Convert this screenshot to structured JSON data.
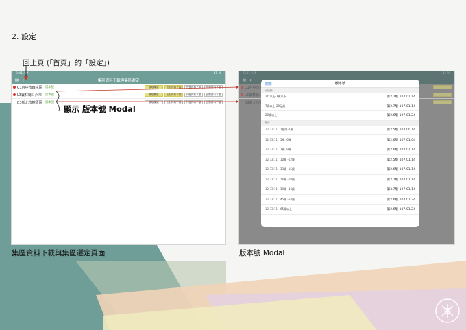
{
  "section": {
    "title": "2. 設定"
  },
  "annotations": {
    "back": "回上頁 (「首頁」的「設定」)",
    "open_modal": "顯示 版本號 Modal"
  },
  "captions": {
    "left": "集區資料下載與集區選定頁面",
    "right": "版本號 Modal"
  },
  "left_screen": {
    "status": {
      "time": "9:41 AM",
      "battery": "41 %"
    },
    "title": "集區資料下載與集區選定",
    "rows": [
      {
        "name": "C1台中市西屯區",
        "version": "版本號",
        "dot": true,
        "buttons": [
          {
            "label": "選取集區",
            "on": true
          },
          {
            "label": "比對資料下載",
            "on": true
          },
          {
            "label": "刊登資料下載",
            "on": false
          },
          {
            "label": "比對資料下載",
            "on": false
          }
        ]
      },
      {
        "name": "L3雲林縣斗六市",
        "version": "版本號",
        "dot": true,
        "buttons": [
          {
            "label": "選取集區",
            "on": true
          },
          {
            "label": "比對資料下載",
            "on": true
          },
          {
            "label": "刊登資料下載",
            "on": false
          },
          {
            "label": "比對資料下載",
            "on": false
          }
        ]
      },
      {
        "name": "B3新北市樹原區",
        "version": "版本號",
        "dot": false,
        "buttons": [
          {
            "label": "選取集區",
            "on": false
          },
          {
            "label": "比對資料下載",
            "on": false
          },
          {
            "label": "刊登資料下載",
            "on": false
          },
          {
            "label": "比對資料下載",
            "on": false
          }
        ]
      }
    ]
  },
  "right_screen": {
    "status": {
      "time": "9:41 AM",
      "battery": "41 %"
    },
    "modal": {
      "close_label": "關閉",
      "title": "版本號",
      "group1_label": "分段籤",
      "group1": [
        {
          "label": "2月以上-7歲以下",
          "value": "第2.1版 107.01.14"
        },
        {
          "label": "7歲以上-20足歲",
          "value": "第2.7版 107.01.14"
        },
        {
          "label": "20歲以上",
          "value": "第2.6版 107.01.24"
        }
      ],
      "group2_label": "細分",
      "group2": [
        {
          "ts": "12:33:11",
          "label": "2個月-1歲",
          "value": "第2.5版 107.00.14"
        },
        {
          "ts": "12:33:11",
          "label": "5歲 -6歲",
          "value": "第2.6版 107.01.04"
        },
        {
          "ts": "12:33:11",
          "label": "7歲 -9歲",
          "value": "第2.6版 107.01.14"
        },
        {
          "ts": "12:33:11",
          "label": "10歲 -12歲",
          "value": "第2.5版 107.01.14"
        },
        {
          "ts": "12:33:11",
          "label": "13歲 -15歲",
          "value": "第2.6版 107.01.14"
        },
        {
          "ts": "12:33:11",
          "label": "16歲 -18歲",
          "value": "第2.1版 107.01.14"
        },
        {
          "ts": "12:33:11",
          "label": "19歲 -44歲",
          "value": "第3.7版 107.01.14"
        },
        {
          "ts": "12:33:11",
          "label": "45歲 -64歲",
          "value": "第2.6版 107.01.24"
        },
        {
          "ts": "12:33:11",
          "label": "65歲以上",
          "value": "第2.6版 107.01.24"
        }
      ]
    },
    "behind_rows": [
      "C1台中市西屯區",
      "L3雲林縣斗六市",
      "B3新北市樹原區"
    ]
  },
  "colors": {
    "accent": "#6f9e98",
    "button_on": "#e6e07f",
    "alert_dot": "#d33333",
    "arrow": "#c0392b"
  }
}
